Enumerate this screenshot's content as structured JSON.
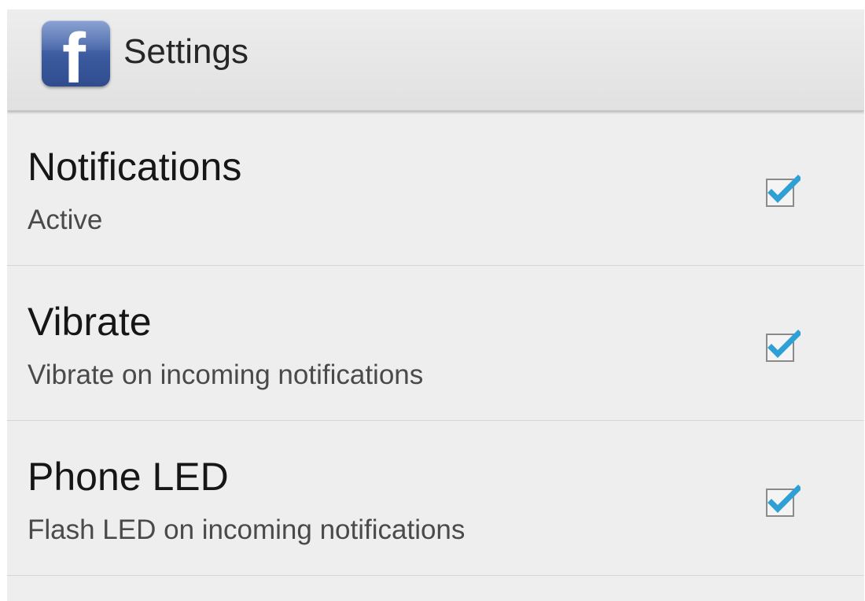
{
  "app_icon_letter": "f",
  "header": {
    "title": "Settings",
    "icon": "facebook-icon"
  },
  "settings": [
    {
      "title": "Notifications",
      "summary": "Active",
      "checked": true
    },
    {
      "title": "Vibrate",
      "summary": "Vibrate on incoming notifications",
      "checked": true
    },
    {
      "title": "Phone LED",
      "summary": "Flash LED on incoming notifications",
      "checked": true
    }
  ],
  "colors": {
    "checkmark": "#2fa0d6",
    "brand": "#3b5998"
  }
}
